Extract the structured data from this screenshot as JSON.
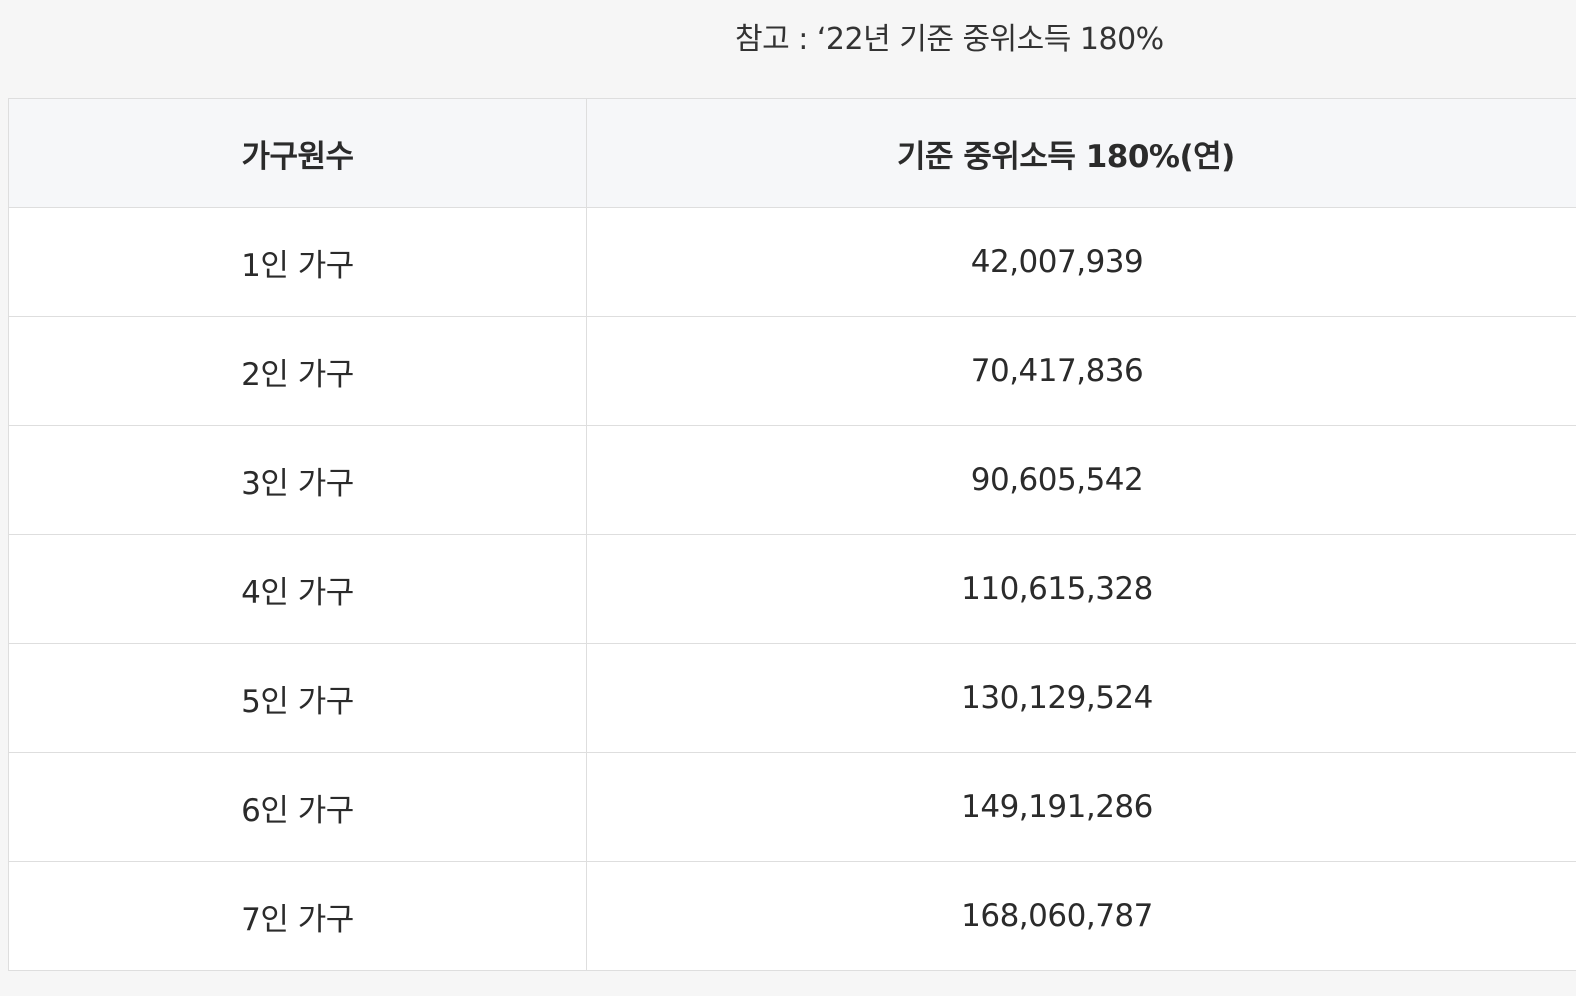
{
  "note": "참고 : ‘22년 기준 중위소득 180%",
  "table": {
    "headers": [
      "가구원수",
      "기준 중위소득 180%(연)"
    ],
    "rows": [
      {
        "household": "1인 가구",
        "amount": "42,007,939"
      },
      {
        "household": "2인 가구",
        "amount": "70,417,836"
      },
      {
        "household": "3인 가구",
        "amount": "90,605,542"
      },
      {
        "household": "4인 가구",
        "amount": "110,615,328"
      },
      {
        "household": "5인 가구",
        "amount": "130,129,524"
      },
      {
        "household": "6인 가구",
        "amount": "149,191,286"
      },
      {
        "household": "7인 가구",
        "amount": "168,060,787"
      }
    ]
  }
}
